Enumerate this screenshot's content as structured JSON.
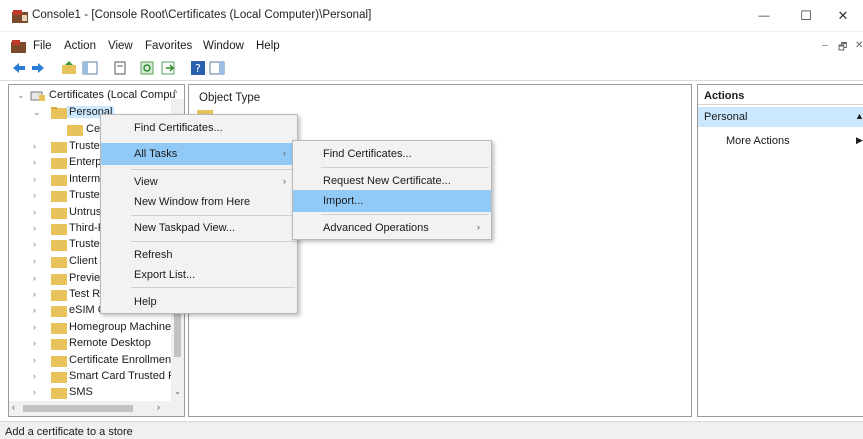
{
  "window": {
    "title": "Console1 - [Console Root\\Certificates (Local Computer)\\Personal]",
    "minimize": "—",
    "maximize": "☐",
    "close": "✕"
  },
  "menubar": {
    "items": [
      "File",
      "Action",
      "View",
      "Favorites",
      "Window",
      "Help"
    ],
    "inner_min": "–",
    "inner_restore": "🗗",
    "inner_close": "✕"
  },
  "tree": {
    "root_label": "Certificates (Local Compu",
    "items": [
      {
        "label": "Personal",
        "expanded": true,
        "selected": true
      },
      {
        "label": "Cer",
        "child": true
      },
      {
        "label": "Trusted"
      },
      {
        "label": "Enterpr"
      },
      {
        "label": "Interme"
      },
      {
        "label": "Trusted"
      },
      {
        "label": "Untrust"
      },
      {
        "label": "Third-P"
      },
      {
        "label": "Trusted"
      },
      {
        "label": "Client A"
      },
      {
        "label": "Preview"
      },
      {
        "label": "Test Ro"
      },
      {
        "label": "eSIM C..."
      },
      {
        "label": "Homegroup Machine"
      },
      {
        "label": "Remote Desktop"
      },
      {
        "label": "Certificate Enrollmen"
      },
      {
        "label": "Smart Card Trusted R"
      },
      {
        "label": "SMS"
      }
    ]
  },
  "center": {
    "column_header": "Object Type"
  },
  "actions": {
    "header": "Actions",
    "section": "Personal",
    "more_actions": "More Actions"
  },
  "context_menu": {
    "items": [
      "Find Certificates...",
      "All Tasks",
      "View",
      "New Window from Here",
      "New Taskpad View...",
      "Refresh",
      "Export List...",
      "Help"
    ]
  },
  "submenu": {
    "items": [
      "Find Certificates...",
      "Request New Certificate...",
      "Import...",
      "Advanced Operations"
    ]
  },
  "status": {
    "text": "Add a certificate to a store"
  },
  "colors": {
    "highlight": "#91c9f7",
    "selection": "#cce8ff",
    "menu_bg": "#f2f2f2",
    "folder": "#e8c25a"
  }
}
